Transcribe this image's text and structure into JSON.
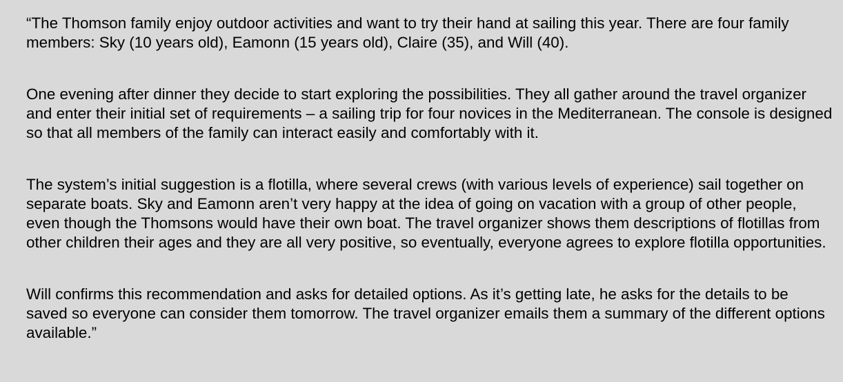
{
  "document": {
    "paragraphs": [
      "“The Thomson family enjoy outdoor activities and want to try their hand at sailing this year. There are four family members: Sky (10 years old), Eamonn (15 years old), Claire (35), and Will (40).",
      "One evening after dinner they decide to start exploring the possibilities. They all gather around the travel organizer and enter their initial set of requirements – a sailing trip for four novices in the Mediterranean. The console is designed so that all members of the family can interact easily and comfortably with it.",
      "The system’s initial suggestion is a flotilla, where several crews (with various levels of experience) sail together on separate boats. Sky and Eamonn aren’t very happy at the idea of going on vacation with a group of other people, even though the Thomsons would have their own boat. The travel organizer shows them descriptions of flotillas from other children their ages and they are all very positive, so eventually, everyone agrees to explore flotilla opportunities.",
      "Will confirms this recommendation and asks for detailed options. As it’s getting late, he asks for the details to be saved so everyone can consider them tomorrow. The travel organizer emails them a summary of the different options available.”"
    ]
  }
}
